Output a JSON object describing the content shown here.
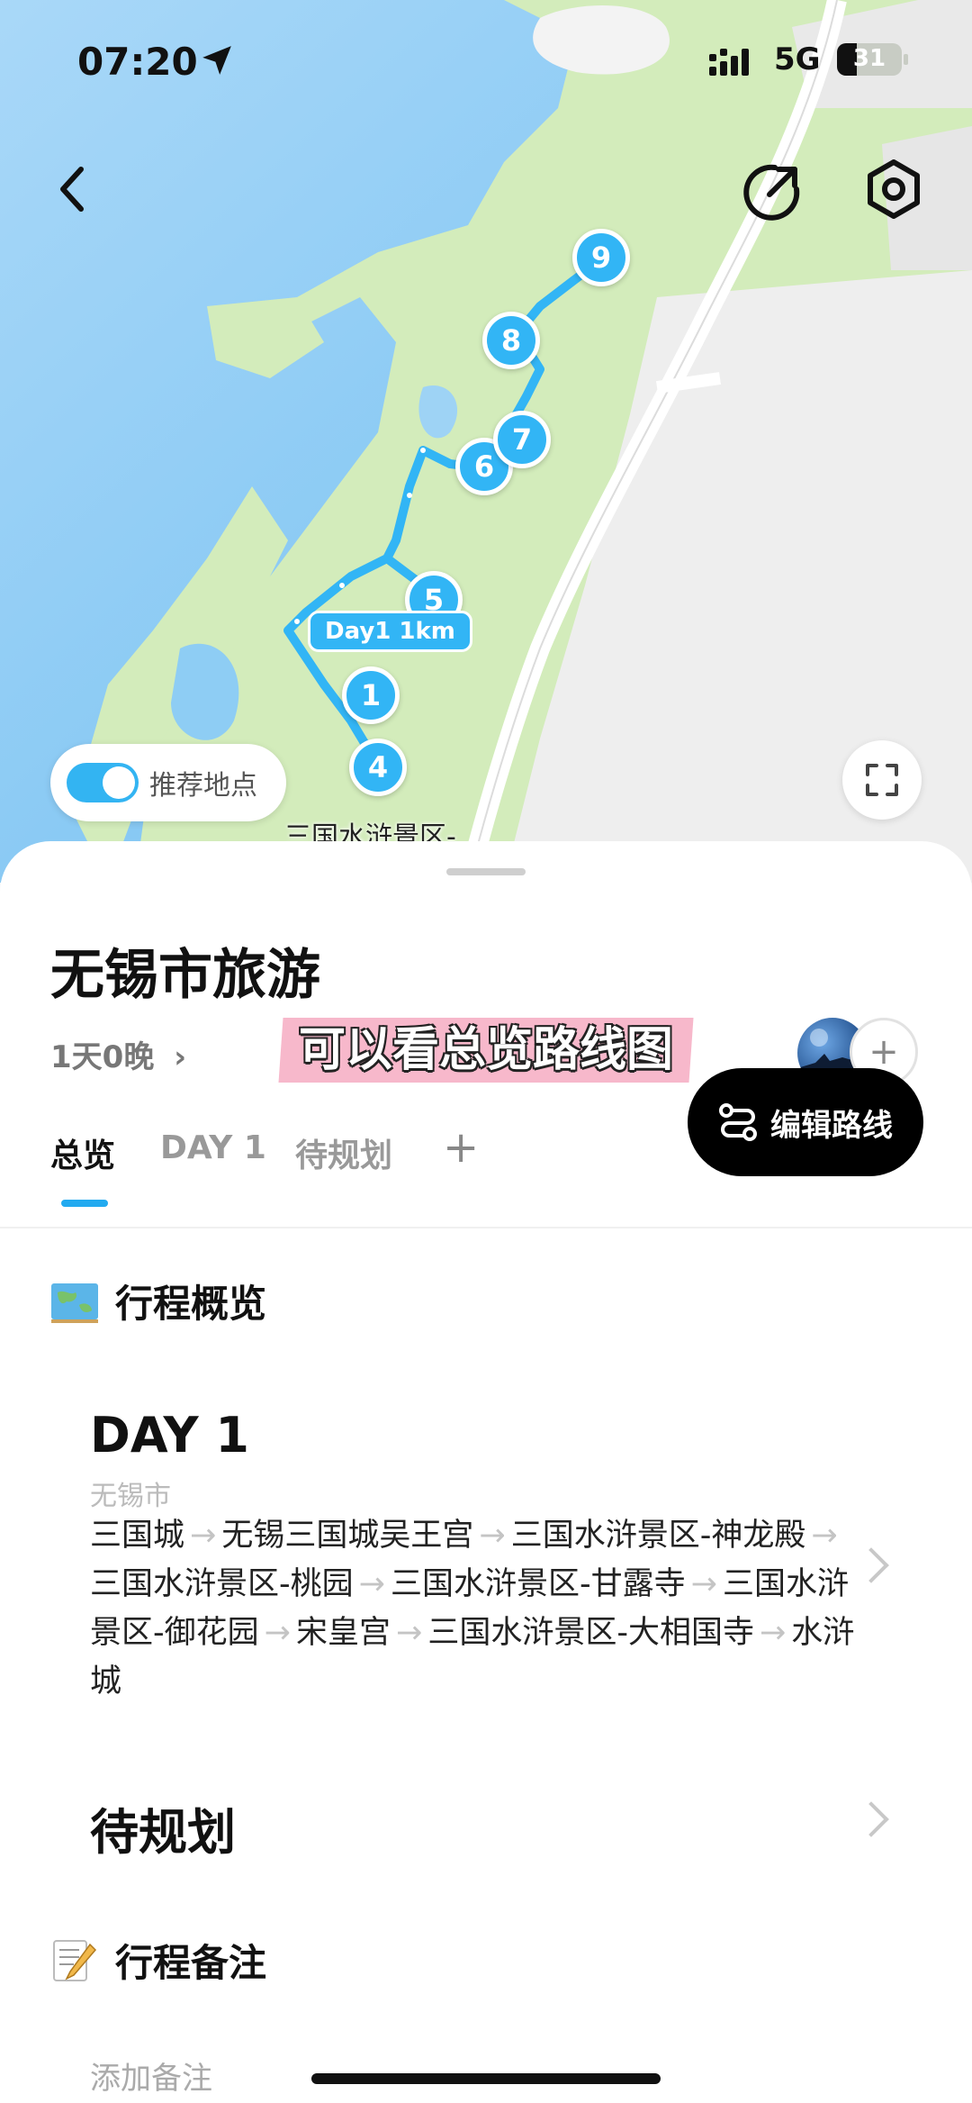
{
  "status_bar": {
    "time": "07:20",
    "network": "5G",
    "battery": "31",
    "battery_level": 0.31,
    "icons": [
      "location-arrow-icon",
      "signal-icon",
      "battery-icon"
    ]
  },
  "map": {
    "markers": [
      "9",
      "8",
      "7",
      "6",
      "5",
      "1",
      "4"
    ],
    "route_label": "Day1 1km",
    "place_label": "三国水浒景区-",
    "toggle_label": "推荐地点",
    "toggle_on": true,
    "colors": {
      "water": "#7fc4f1",
      "land": "#cfe9b5",
      "road": "#ffffff",
      "route": "#32b5f5"
    }
  },
  "trip": {
    "title": "无锡市旅游",
    "duration": "1天0晚",
    "caption": "可以看总览路线图"
  },
  "tabs": [
    "总览",
    "DAY 1",
    "待规划",
    "+"
  ],
  "overview": {
    "heading": "行程概览",
    "day_card": {
      "title": "DAY 1",
      "city": "无锡市",
      "stops": [
        "三国城",
        "无锡三国城吴王宫",
        "三国水浒景区-神龙殿",
        "三国水浒景区-桃园",
        "三国水浒景区-甘露寺",
        "三国水浒景区-御花园",
        "宋皇宫",
        "三国水浒景区-大相国寺",
        "水浒城"
      ]
    },
    "pending_card": {
      "title": "待规划"
    }
  },
  "notes": {
    "heading": "行程备注",
    "placeholder": "添加备注"
  },
  "edit_button": "编辑路线",
  "accent_color": "#22aaf0"
}
